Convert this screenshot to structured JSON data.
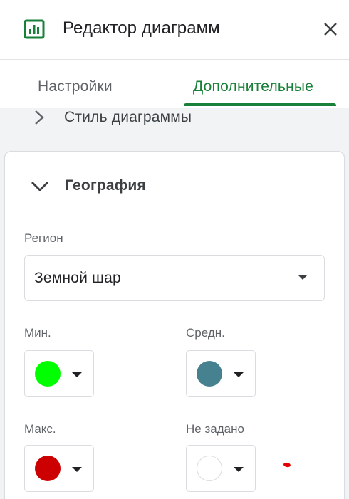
{
  "header": {
    "title": "Редактор диаграмм",
    "icon": "chart-icon",
    "close_icon": "close-icon",
    "accent": "#188038"
  },
  "tabs": [
    {
      "label": "Настройки",
      "active": false
    },
    {
      "label": "Дополнительные",
      "active": true
    }
  ],
  "sections": {
    "chart_style": {
      "label": "Стиль диаграммы",
      "expanded": false
    },
    "geography": {
      "label": "География",
      "expanded": true,
      "region": {
        "label": "Регион",
        "value": "Земной шар"
      },
      "colors": {
        "min": {
          "label": "Мин.",
          "color": "#00ff00"
        },
        "mid": {
          "label": "Средн.",
          "color": "#45818e"
        },
        "max": {
          "label": "Макс.",
          "color": "#cc0000"
        },
        "none": {
          "label": "Не задано",
          "color": "#ffffff"
        }
      }
    }
  }
}
